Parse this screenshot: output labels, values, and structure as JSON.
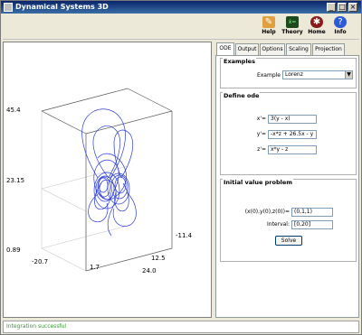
{
  "window": {
    "title": "Dynamical Systems 3D",
    "controls": [
      "_",
      "□",
      "×"
    ]
  },
  "toolbar": {
    "items": [
      {
        "label": "Help",
        "icon": "help-book-icon"
      },
      {
        "label": "Theory",
        "icon": "theory-formula-icon"
      },
      {
        "label": "Home",
        "icon": "home-bug-icon"
      },
      {
        "label": "Info",
        "icon": "info-question-icon"
      }
    ]
  },
  "plot": {
    "z_ticks": [
      "45.4",
      "23.15",
      "0.89"
    ],
    "x_ticks": [
      "-20.7",
      "1.7",
      "24.0"
    ],
    "y_ticks": [
      "-11.4",
      "12.5"
    ],
    "curve_color": "#2a3bd6"
  },
  "tabs": [
    "ODE",
    "Output",
    "Options",
    "Scaling",
    "Projection"
  ],
  "examples": {
    "title": "Examples",
    "label": "Example",
    "value": "Lorenz"
  },
  "define_ode": {
    "title": "Define ode",
    "rows": [
      {
        "label": "x'=",
        "value": "3(y - x)"
      },
      {
        "label": "y'=",
        "value": "-x*z + 26.5x - y"
      },
      {
        "label": "z'=",
        "value": "x*y - z"
      }
    ]
  },
  "ivp": {
    "title": "Initial value problem",
    "init_label": "(x(0),y(0),z(0))=",
    "init_value": "(0,1,1)",
    "interval_label": "Interval:",
    "interval_value": "[0,20]",
    "solve_label": "Solve"
  },
  "status": {
    "text": "Integration successful"
  }
}
